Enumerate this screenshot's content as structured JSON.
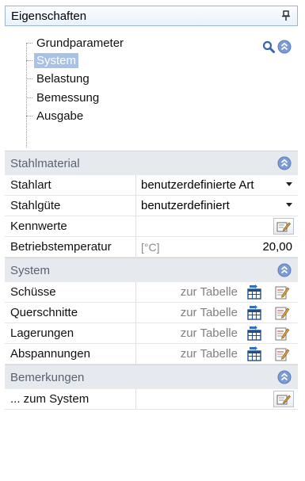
{
  "panel": {
    "title": "Eigenschaften"
  },
  "tree": {
    "items": [
      {
        "label": "Grundparameter",
        "selected": false
      },
      {
        "label": "System",
        "selected": true
      },
      {
        "label": "Belastung",
        "selected": false
      },
      {
        "label": "Bemessung",
        "selected": false
      },
      {
        "label": "Ausgabe",
        "selected": false
      }
    ]
  },
  "sections": {
    "stahlmaterial": {
      "title": "Stahlmaterial",
      "rows": {
        "stahlart": {
          "name": "Stahlart",
          "value": "benutzerdefinierte Art"
        },
        "stahlguete": {
          "name": "Stahlgüte",
          "value": "benutzerdefiniert"
        },
        "kennwerte": {
          "name": "Kennwerte"
        },
        "betriebstemperatur": {
          "name": "Betriebstemperatur",
          "unit": "[°C]",
          "value": "20,00"
        }
      }
    },
    "system": {
      "title": "System",
      "link_label": "zur Tabelle",
      "rows": {
        "schuesse": {
          "name": "Schüsse"
        },
        "querschnitte": {
          "name": "Querschnitte"
        },
        "lagerungen": {
          "name": "Lagerungen"
        },
        "abspannungen": {
          "name": "Abspannungen"
        }
      }
    },
    "bemerkungen": {
      "title": "Bemerkungen",
      "rows": {
        "zum_system": {
          "name": "... zum System"
        }
      }
    }
  },
  "colors": {
    "header_border": "#9eb6d3",
    "section_bg": "#e6e9ee",
    "selection": "#a8c2e6",
    "toggle_blue": "#6b8fcf"
  }
}
